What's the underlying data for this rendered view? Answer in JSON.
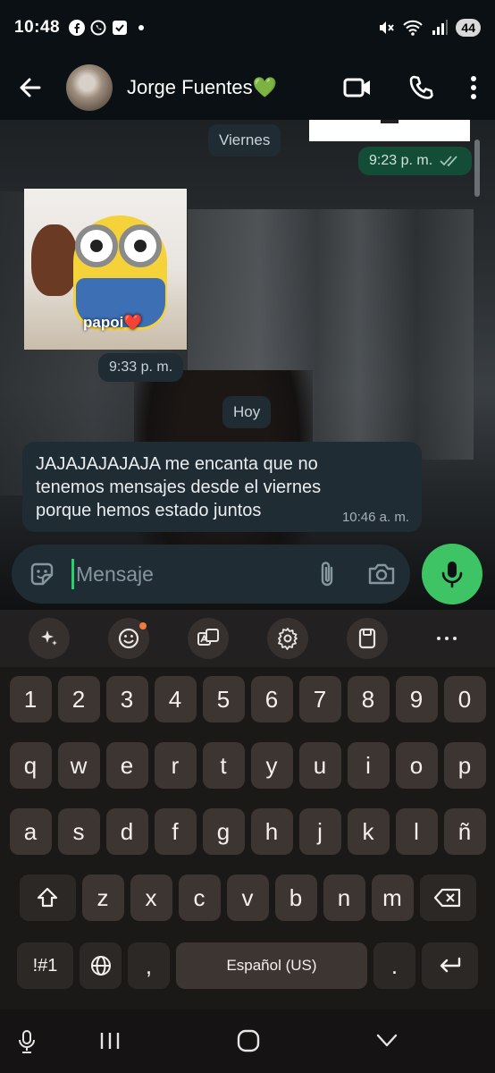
{
  "status_bar": {
    "time": "10:48",
    "battery": "44"
  },
  "header": {
    "contact_name": "Jorge Fuentes",
    "contact_emoji": "💚"
  },
  "chat": {
    "date_friday": "Viernes",
    "outgoing_time": "9:23 p. m.",
    "sticker_caption": "papoi",
    "sticker_emoji": "❤️",
    "sticker_time": "9:33 p. m.",
    "date_today": "Hoy",
    "incoming_text": "JAJAJAJAJAJA me encanta que no tenemos mensajes desde el viernes porque hemos estado juntos",
    "incoming_time": "10:46 a. m."
  },
  "composer": {
    "placeholder": "Mensaje"
  },
  "keyboard": {
    "row_numbers": [
      "1",
      "2",
      "3",
      "4",
      "5",
      "6",
      "7",
      "8",
      "9",
      "0"
    ],
    "row_q": [
      "q",
      "w",
      "e",
      "r",
      "t",
      "y",
      "u",
      "i",
      "o",
      "p"
    ],
    "row_a": [
      "a",
      "s",
      "d",
      "f",
      "g",
      "h",
      "j",
      "k",
      "l",
      "ñ"
    ],
    "row_z": [
      "z",
      "x",
      "c",
      "v",
      "b",
      "n",
      "m"
    ],
    "symbols_label": "!#1",
    "comma_label": ",",
    "space_label": "Español (US)",
    "period_label": "."
  },
  "colors": {
    "outgoing_bubble": "#144d37",
    "incoming_bubble": "#1f2c33",
    "accent_green": "#3ec465"
  }
}
